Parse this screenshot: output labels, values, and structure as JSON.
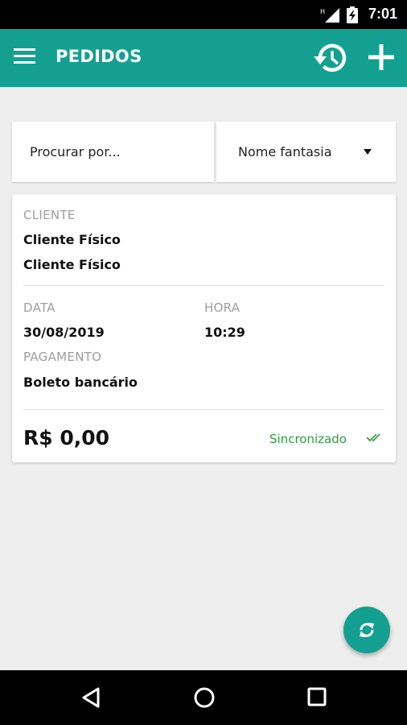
{
  "status_bar": {
    "time": "7:01",
    "network_label": "H"
  },
  "app_bar": {
    "title": "PEDIDOS",
    "menu_icon": "menu-icon",
    "history_icon": "history-icon",
    "add_icon": "add-icon"
  },
  "search": {
    "placeholder": "Procurar por...",
    "value": "",
    "filter_selected": "Nome fantasia"
  },
  "order": {
    "cliente_label": "CLIENTE",
    "cliente_line1": "Cliente Físico",
    "cliente_line2": "Cliente Físico",
    "data_label": "DATA",
    "data_value": "30/08/2019",
    "hora_label": "HORA",
    "hora_value": "10:29",
    "pagamento_label": "PAGAMENTO",
    "pagamento_value": "Boleto bancário",
    "total": "R$ 0,00",
    "sync_status": "Sincronizado"
  },
  "colors": {
    "primary": "#13a090",
    "success": "#2e9e3e",
    "label": "#9e9e9e"
  },
  "fab_icon": "sync-icon",
  "nav_icons": [
    "back-icon",
    "home-icon",
    "recent-apps-icon"
  ]
}
